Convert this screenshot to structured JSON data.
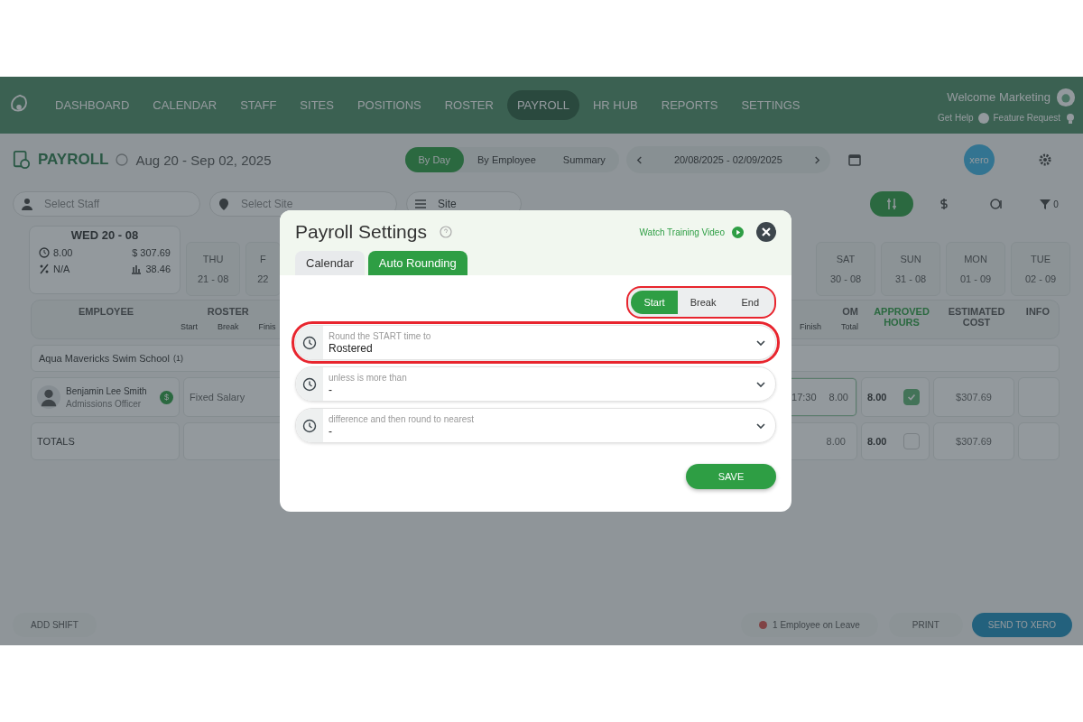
{
  "nav": {
    "items": [
      {
        "label": "DASHBOARD",
        "selected": false
      },
      {
        "label": "CALENDAR",
        "selected": false
      },
      {
        "label": "STAFF",
        "selected": false
      },
      {
        "label": "SITES",
        "selected": false
      },
      {
        "label": "POSITIONS",
        "selected": false
      },
      {
        "label": "ROSTER",
        "selected": false
      },
      {
        "label": "PAYROLL",
        "selected": true
      },
      {
        "label": "HR HUB",
        "selected": false
      },
      {
        "label": "REPORTS",
        "selected": false
      },
      {
        "label": "SETTINGS",
        "selected": false
      }
    ],
    "welcome": "Welcome Marketing",
    "get_help": "Get Help",
    "feature_request": "Feature Request"
  },
  "header": {
    "title": "PAYROLL",
    "date_range": "Aug 20 - Sep 02, 2025",
    "views": [
      {
        "label": "By Day",
        "selected": true
      },
      {
        "label": "By Employee",
        "selected": false
      },
      {
        "label": "Summary",
        "selected": false
      }
    ],
    "period": "20/08/2025 - 02/09/2025",
    "xero": "xero"
  },
  "filters": {
    "staff_placeholder": "Select Staff",
    "site_placeholder": "Select Site",
    "group_by": "Site",
    "filter_count": "0"
  },
  "day_summary": {
    "day": "WED 20 - 08",
    "hours": "8.00",
    "cost": "$ 307.69",
    "percent": "N/A",
    "average": "38.46"
  },
  "days_left": [
    {
      "day": "THU",
      "date": "21 - 08"
    },
    {
      "day": "F",
      "date": "22"
    }
  ],
  "days_right": [
    {
      "day": "SAT",
      "date": "30 - 08"
    },
    {
      "day": "SUN",
      "date": "31 - 08"
    },
    {
      "day": "MON",
      "date": "01 - 09"
    },
    {
      "day": "TUE",
      "date": "02 - 09"
    }
  ],
  "table": {
    "employee_heading": "EMPLOYEE",
    "roster_heading": "ROSTER",
    "roster_subs": [
      "Start",
      "Break",
      "Finis"
    ],
    "clocked_heading": "OM",
    "clocked_subs": [
      "Finish",
      "Total"
    ],
    "approved_heading": "APPROVED HOURS",
    "cost_heading": "ESTIMATED COST",
    "info_heading": "INFO",
    "group": {
      "name": "Aqua Mavericks Swim School",
      "count": "(1)"
    },
    "rows": [
      {
        "name": "Benjamin Lee Smith",
        "role": "Admissions Officer",
        "badge": "$",
        "roster": "Fixed Salary",
        "finish": "17:30",
        "total": "8.00",
        "approved": "8.00",
        "checked": true,
        "cost": "$307.69"
      }
    ],
    "totals": {
      "label": "TOTALS",
      "total": "8.00",
      "approved": "8.00",
      "checked": false,
      "cost": "$307.69"
    }
  },
  "footer": {
    "add_shift": "ADD SHIFT",
    "leave": "1 Employee on Leave",
    "print": "PRINT",
    "send": "SEND TO XERO"
  },
  "modal": {
    "title": "Payroll Settings",
    "video_link": "Watch Training Video",
    "tabs": [
      {
        "label": "Calendar",
        "selected": false
      },
      {
        "label": "Auto Rounding",
        "selected": true
      }
    ],
    "segments_highlighted": true,
    "segments": [
      {
        "label": "Start",
        "selected": true
      },
      {
        "label": "Break",
        "selected": false
      },
      {
        "label": "End",
        "selected": false
      }
    ],
    "fields": [
      {
        "label": "Round the START time to",
        "value": "Rostered",
        "highlighted": true
      },
      {
        "label": "unless is more than",
        "value": "-",
        "highlighted": false
      },
      {
        "label": "difference and then round to nearest",
        "value": "-",
        "highlighted": false
      }
    ],
    "save": "SAVE"
  }
}
